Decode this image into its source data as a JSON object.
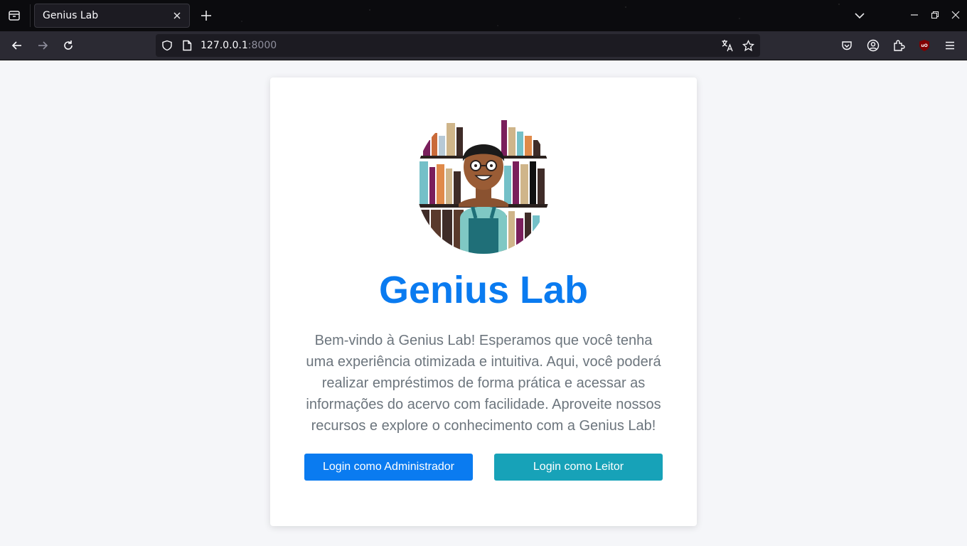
{
  "browser": {
    "tab_title": "Genius Lab",
    "url_host": "127.0.0.1",
    "url_port": ":8000"
  },
  "icons": {
    "tab_list": "tab-list-icon",
    "close_tab": "close-icon",
    "new_tab": "plus-icon",
    "tab_overflow": "chevron-down-icon",
    "back": "arrow-left-icon",
    "forward": "arrow-right-icon",
    "reload": "reload-icon",
    "shield": "shield-icon",
    "page": "page-icon",
    "translate": "translate-icon",
    "bookmark": "star-icon",
    "pocket": "pocket-icon",
    "account": "account-icon",
    "extensions": "puzzle-icon",
    "ublock": "ublock-icon",
    "menu": "hamburger-menu-icon"
  },
  "page": {
    "title": "Genius Lab",
    "description": "Bem-vindo à Genius Lab! Esperamos que você tenha uma experiência otimizada e intuitiva. Aqui, você poderá realizar empréstimos de forma prática e acessar as informações do acervo com facilidade. Aproveite nossos recursos e explore o conhecimento com a Genius Lab!",
    "buttons": {
      "admin_login": "Login como Administrador",
      "reader_login": "Login como Leitor"
    }
  },
  "colors": {
    "title": "#0a7bf0",
    "admin_button": "#0a7bf0",
    "reader_button": "#17a2b8",
    "page_background": "#f5f6f9",
    "description_text": "#6c757d"
  }
}
